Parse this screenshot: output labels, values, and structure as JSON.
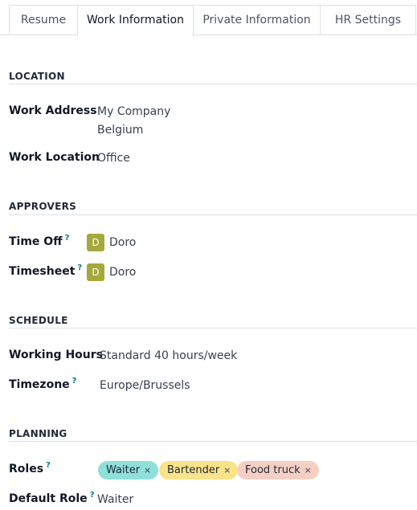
{
  "tabs": [
    {
      "label": "Resume"
    },
    {
      "label": "Work Information"
    },
    {
      "label": "Private Information"
    },
    {
      "label": "HR Settings"
    }
  ],
  "active_tab": "Work Information",
  "location": {
    "title": "LOCATION",
    "work_address_label": "Work Address",
    "work_address_line1": "My Company",
    "work_address_line2": "Belgium",
    "work_location_label": "Work Location",
    "work_location_value": "Office"
  },
  "approvers": {
    "title": "APPROVERS",
    "time_off_label": "Time Off",
    "time_off_user": {
      "initial": "D",
      "name": "Doro"
    },
    "timesheet_label": "Timesheet",
    "timesheet_user": {
      "initial": "D",
      "name": "Doro"
    }
  },
  "schedule": {
    "title": "SCHEDULE",
    "working_hours_label": "Working Hours",
    "working_hours_value": "Standard 40 hours/week",
    "timezone_label": "Timezone",
    "timezone_value": "Europe/Brussels"
  },
  "planning": {
    "title": "PLANNING",
    "roles_label": "Roles",
    "roles": [
      {
        "label": "Waiter",
        "color": "#8ee0d9"
      },
      {
        "label": "Bartender",
        "color": "#fbe38a"
      },
      {
        "label": "Food truck",
        "color": "#f5cfc3"
      }
    ],
    "default_role_label": "Default Role",
    "default_role_value": "Waiter"
  },
  "help_mark": "?",
  "remove_mark": "×"
}
